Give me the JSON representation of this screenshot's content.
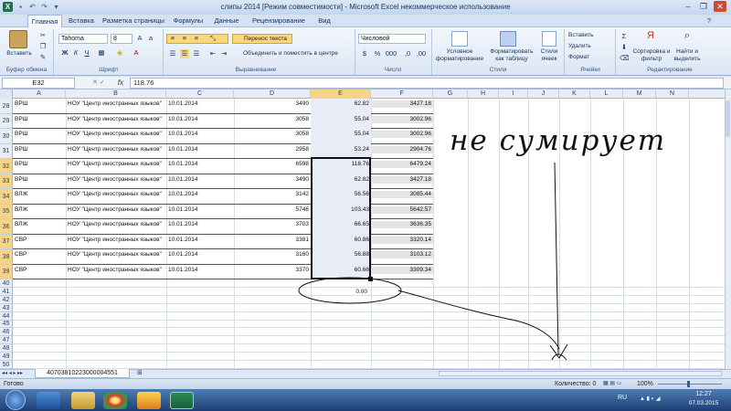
{
  "window": {
    "title": "слипы 2014  [Режим совместимости] - Microsoft Excel некоммерческое использование",
    "minimize": "–",
    "restore": "❐",
    "close": "✕",
    "help": "?"
  },
  "menu": {
    "items": [
      "Главная",
      "Вставка",
      "Разметка страницы",
      "Формулы",
      "Данные",
      "Рецензирование",
      "Вид"
    ]
  },
  "ribbon": {
    "paste_label": "Вставить",
    "clipboard_label": "Буфер обмена",
    "font_name": "Tahoma",
    "font_size": "8",
    "font_label": "Шрифт",
    "wrap_text": "Перенос текста",
    "merge_center": "Объединить и поместить в центре",
    "alignment_label": "Выравнивание",
    "number_format": "Числовой",
    "number_label": "Число",
    "conditional_format": "Условное форматирование",
    "format_table": "Форматировать как таблицу",
    "cell_styles": "Стили ячеек",
    "styles_label": "Стили",
    "insert": "Вставить",
    "delete": "Удалить",
    "format": "Формат",
    "cells_label": "Ячейки",
    "sort_filter": "Сортировка и фильтр",
    "find_select": "Найти и выделить",
    "editing_label": "Редактирование",
    "percent": "%",
    "thousands": "000",
    "dec_increase": ",0",
    "dec_decrease": ",00"
  },
  "formula_bar": {
    "name_box": "E32",
    "fx": "fx",
    "value": "118.76"
  },
  "columns": [
    "A",
    "B",
    "C",
    "D",
    "E",
    "F",
    "G",
    "H",
    "I",
    "J",
    "K",
    "L",
    "M",
    "N"
  ],
  "rows": [
    {
      "n": "28",
      "a": "ВРШ",
      "b": "НОУ \"Центр иностранных языков\"",
      "c": "10.01.2014",
      "d": "3490",
      "e": "62.82",
      "f": "3427.18"
    },
    {
      "n": "29",
      "a": "ВРШ",
      "b": "НОУ \"Центр иностранных языков\"",
      "c": "10.01.2014",
      "d": "3058",
      "e": "55.04",
      "f": "3002.96"
    },
    {
      "n": "30",
      "a": "ВРШ",
      "b": "НОУ \"Центр иностранных языков\"",
      "c": "10.01.2014",
      "d": "3058",
      "e": "55.04",
      "f": "3002.96"
    },
    {
      "n": "31",
      "a": "ВРШ",
      "b": "НОУ \"Центр иностранных языков\"",
      "c": "10.01.2014",
      "d": "2958",
      "e": "53.24",
      "f": "2904.76"
    },
    {
      "n": "32",
      "a": "ВРШ",
      "b": "НОУ \"Центр иностранных языков\"",
      "c": "10.01.2014",
      "d": "6598",
      "e": "118.76",
      "f": "6479.24"
    },
    {
      "n": "33",
      "a": "ВРШ",
      "b": "НОУ \"Центр иностранных языков\"",
      "c": "10.01.2014",
      "d": "3490",
      "e": "62.82",
      "f": "3427.18"
    },
    {
      "n": "34",
      "a": "ВЛЖ",
      "b": "НОУ \"Центр иностранных языков\"",
      "c": "10.01.2014",
      "d": "3142",
      "e": "56.56",
      "f": "3085.44"
    },
    {
      "n": "35",
      "a": "ВЛЖ",
      "b": "НОУ \"Центр иностранных языков\"",
      "c": "10.01.2014",
      "d": "5746",
      "e": "103.43",
      "f": "5642.57"
    },
    {
      "n": "36",
      "a": "ВЛЖ",
      "b": "НОУ \"Центр иностранных языков\"",
      "c": "10.01.2014",
      "d": "3703",
      "e": "66.65",
      "f": "3636.35"
    },
    {
      "n": "37",
      "a": "СВР",
      "b": "НОУ \"Центр иностранных языков\"",
      "c": "10.01.2014",
      "d": "3381",
      "e": "60.86",
      "f": "3320.14"
    },
    {
      "n": "38",
      "a": "СВР",
      "b": "НОУ \"Центр иностранных языков\"",
      "c": "10.01.2014",
      "d": "3160",
      "e": "56.88",
      "f": "3103.12"
    },
    {
      "n": "39",
      "a": "СВР",
      "b": "НОУ \"Центр иностранных языков\"",
      "c": "10.01.2014",
      "d": "3370",
      "e": "60.66",
      "f": "3309.34"
    }
  ],
  "empty_rows": [
    "40",
    "41",
    "42",
    "43",
    "44",
    "45",
    "46",
    "47",
    "48",
    "49",
    "50"
  ],
  "sum_cell": "0.00",
  "annotation": {
    "handwritten_text": "не сумирует"
  },
  "sheet_tab": "40703810223000004551",
  "status": {
    "ready": "Готово",
    "count": "Количество: 0",
    "zoom": "100%"
  },
  "taskbar": {
    "lang": "RU",
    "time": "12:27",
    "date": "07.03.2015"
  },
  "colors": {
    "selection": "#e8ecf6",
    "selected_header": "#f6d38a",
    "ribbon": "#dbe6f4",
    "taskbar": "#1d3f74"
  }
}
